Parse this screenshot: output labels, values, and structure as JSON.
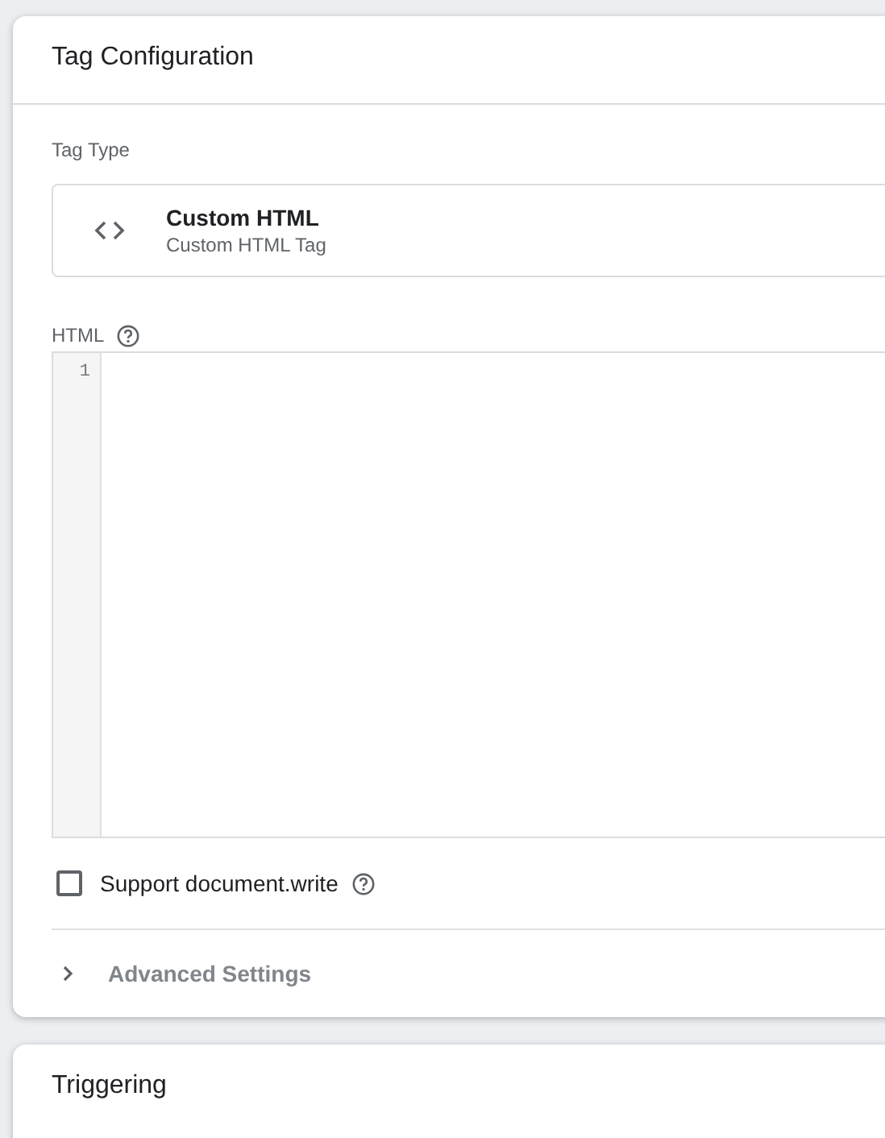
{
  "tag_configuration": {
    "title": "Tag Configuration",
    "tag_type_label": "Tag Type",
    "tag_type": {
      "name": "Custom HTML",
      "description": "Custom HTML Tag"
    },
    "html_label": "HTML",
    "editor": {
      "line_numbers": [
        "1"
      ]
    },
    "support_document_write": {
      "label": "Support document.write",
      "checked": false
    },
    "advanced_settings": {
      "label": "Advanced Settings",
      "expanded": false
    }
  },
  "triggering": {
    "title": "Triggering"
  }
}
